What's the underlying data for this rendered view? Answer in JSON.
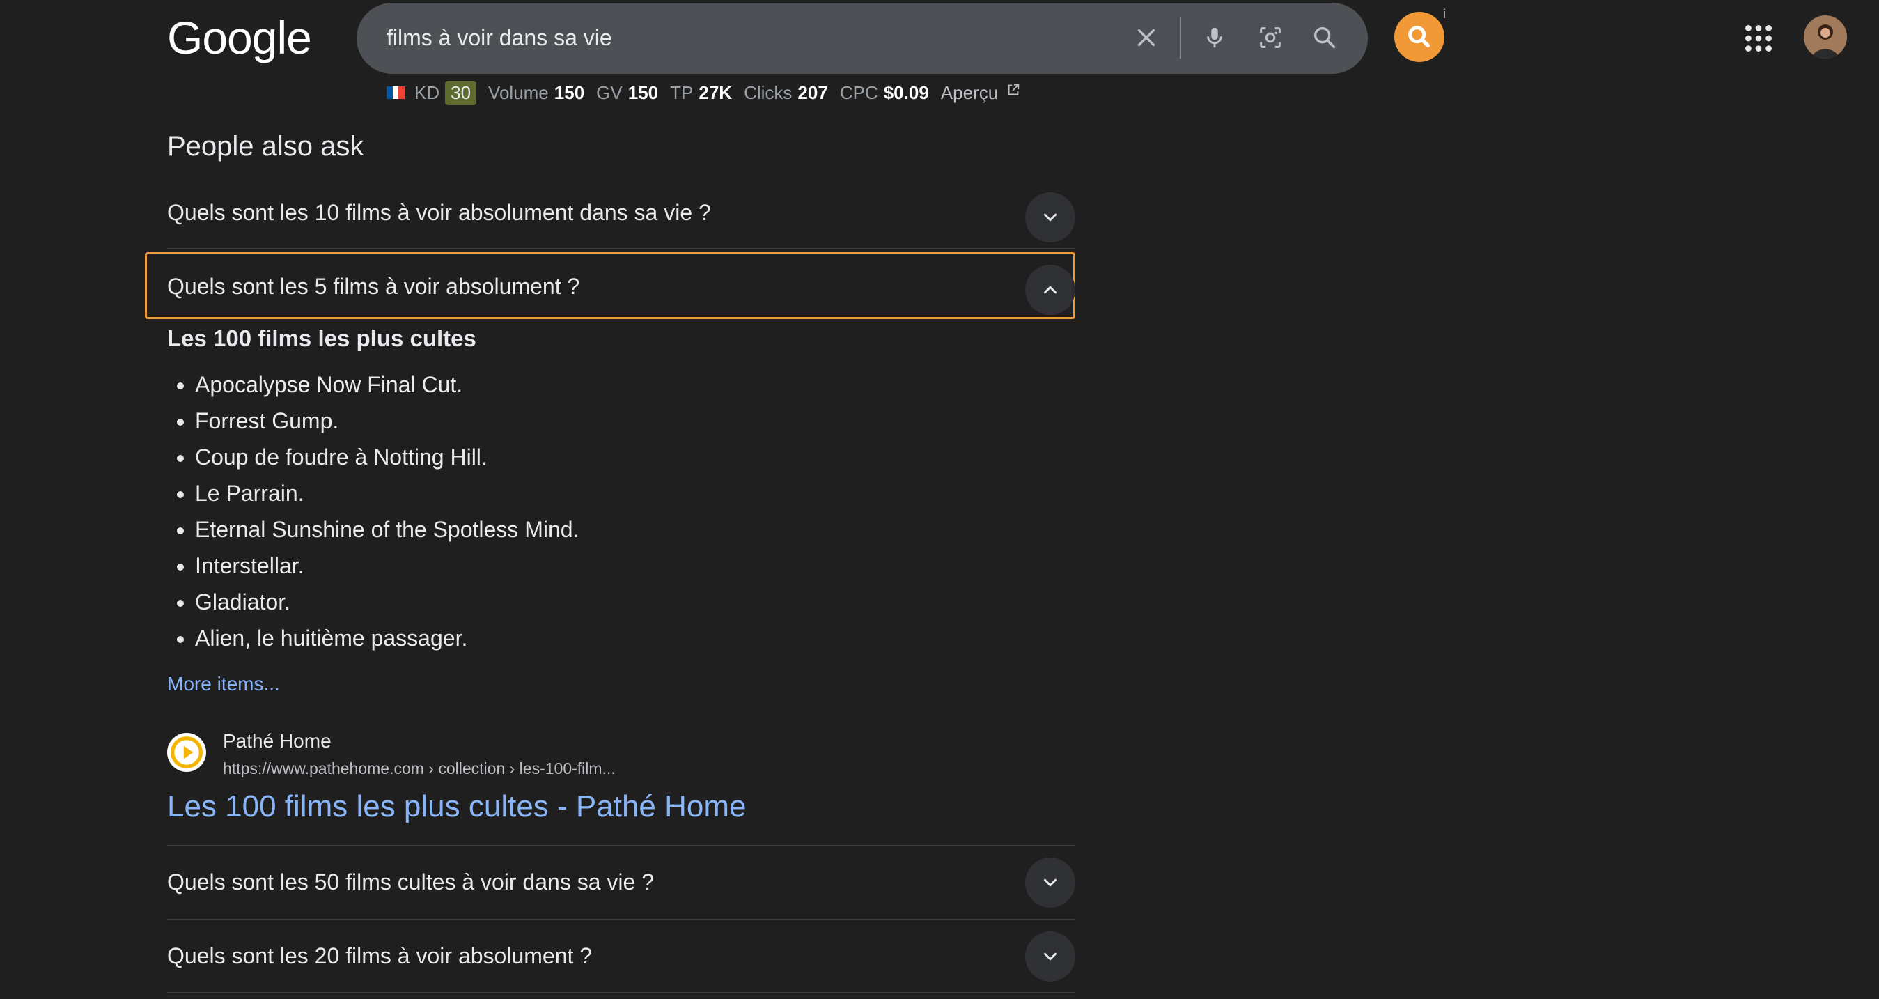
{
  "header": {
    "logo_text": "Google",
    "query": "films à voir dans sa vie",
    "ext_info": "i"
  },
  "metrics": {
    "kd_label": "KD",
    "kd_value": "30",
    "volume_label": "Volume",
    "volume_value": "150",
    "gv_label": "GV",
    "gv_value": "150",
    "tp_label": "TP",
    "tp_value": "27K",
    "clicks_label": "Clicks",
    "clicks_value": "207",
    "cpc_label": "CPC",
    "cpc_value": "$0.09",
    "apercu_label": "Aperçu"
  },
  "paa": {
    "title": "People also ask",
    "questions": [
      {
        "text": "Quels sont les 10 films à voir absolument dans sa vie ?",
        "expanded": false
      },
      {
        "text": "Quels sont les 5 films à voir absolument ?",
        "expanded": true
      },
      {
        "text": "Quels sont les 50 films cultes à voir dans sa vie ?",
        "expanded": false
      },
      {
        "text": "Quels sont les 20 films à voir absolument ?",
        "expanded": false
      }
    ],
    "answer": {
      "heading": "Les 100 films les plus cultes",
      "items": [
        "Apocalypse Now Final Cut.",
        "Forrest Gump.",
        "Coup de foudre à Notting Hill.",
        "Le Parrain.",
        "Eternal Sunshine of the Spotless Mind.",
        "Interstellar.",
        "Gladiator.",
        "Alien, le huitième passager."
      ],
      "more_items": "More items...",
      "source_name": "Pathé Home",
      "source_url": "https://www.pathehome.com › collection › les-100-film...",
      "source_title": "Les 100 films les plus cultes - Pathé Home"
    }
  },
  "icons": {
    "clear": "close-icon",
    "mic": "microphone-icon",
    "lens": "camera-lens-icon",
    "search": "search-icon",
    "apps": "apps-grid-icon",
    "chevron_down": "chevron-down-icon",
    "chevron_up": "chevron-up-icon",
    "external": "external-link-icon",
    "source": "play-icon"
  },
  "colors": {
    "background": "#1f1f1f",
    "search_bar": "#4d5156",
    "link": "#8ab4f8",
    "highlight": "#f19937",
    "kd_badge": "#5f6b2e"
  }
}
